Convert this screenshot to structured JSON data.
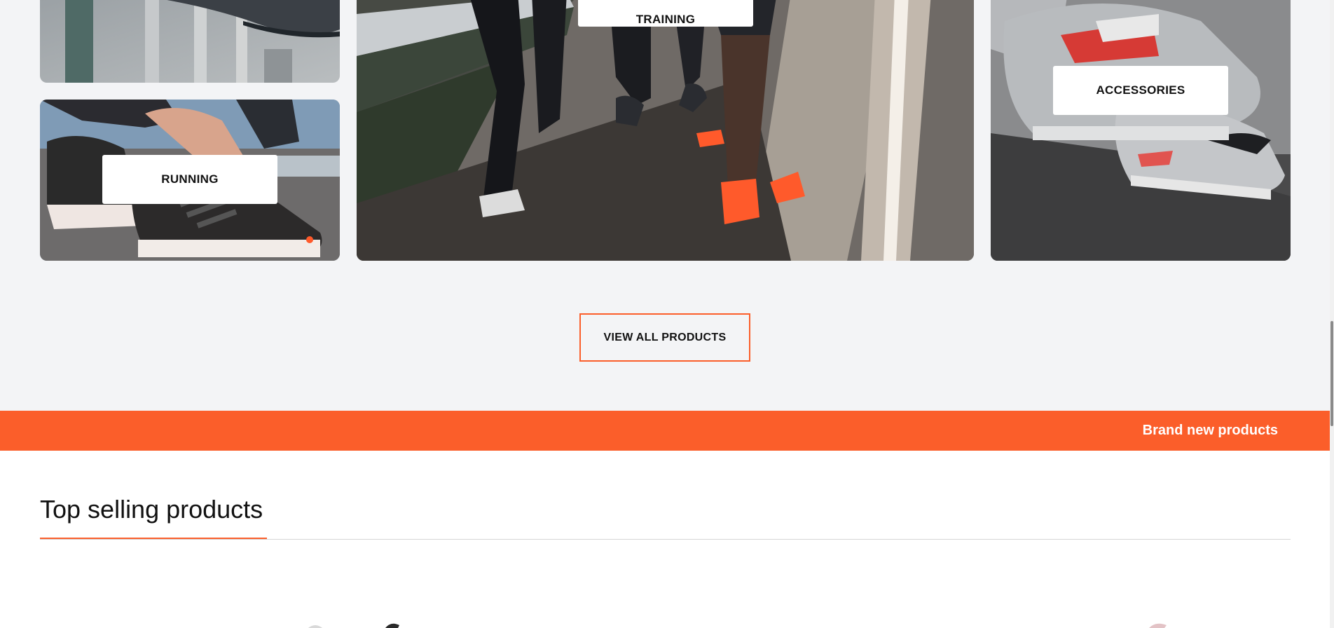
{
  "categories": {
    "running_label": "RUNNING",
    "training_label": "TRAINING",
    "accessories_label": "ACCESSORIES"
  },
  "view_all": {
    "label": "VIEW ALL PRODUCTS"
  },
  "banner": {
    "text": "Brand new products",
    "color": "#fb5e2a"
  },
  "top_selling": {
    "title": "Top selling products"
  },
  "colors": {
    "accent": "#fb5e2a",
    "page_bg": "#f3f4f6",
    "section_bg": "#ffffff",
    "text": "#111111"
  }
}
